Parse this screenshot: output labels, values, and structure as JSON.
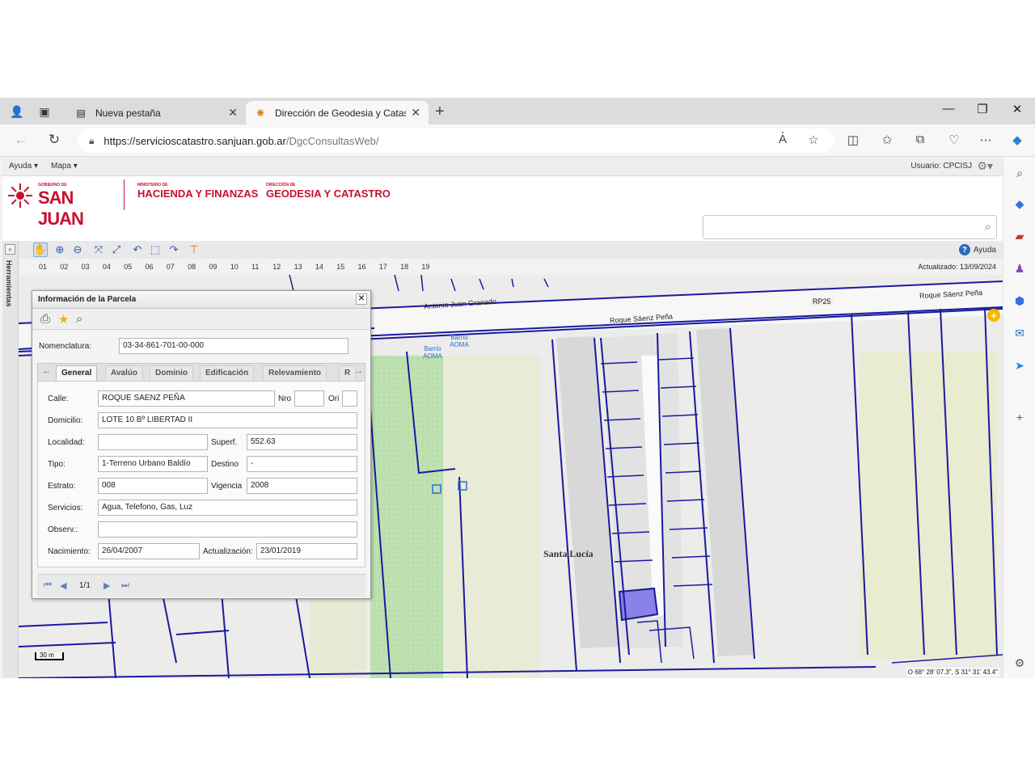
{
  "browser": {
    "tabs": [
      {
        "title": "Nueva pestaña",
        "active": false
      },
      {
        "title": "Dirección de Geodesia y Catastro",
        "active": true
      }
    ],
    "url_host": "https://servicioscatastro.sanjuan.gob.ar",
    "url_path": "/DgcConsultasWeb/"
  },
  "menubar": {
    "help": "Ayuda",
    "map": "Mapa",
    "user": "Usuario: CPCISJ"
  },
  "header": {
    "gob_small": "GOBIERNO DE",
    "gob_big": "SAN JUAN",
    "ministry_small": "MINISTERIO DE",
    "ministry_big": "HACIENDA Y FINANZAS",
    "direction_small": "DIRECCIÓN DE",
    "direction_big": "GEODESIA Y CATASTRO",
    "brand_color": "#c8102e"
  },
  "toolbar": {
    "help": "Ayuda",
    "side_label": "Herramientas",
    "numbers": [
      "01",
      "02",
      "03",
      "04",
      "05",
      "06",
      "07",
      "08",
      "09",
      "10",
      "11",
      "12",
      "13",
      "14",
      "15",
      "16",
      "17",
      "18",
      "19"
    ],
    "updated": "Actualizado: 13/09/2024"
  },
  "map": {
    "labels": {
      "street1": "Antonio Juan Granado",
      "street2": "Roque Sáenz Peña",
      "street3": "Roque Sáenz Peña",
      "route": "RP25",
      "poi1": "Barrio AOMA",
      "poi2": "Barrio AOMA",
      "place": "Santa Lucía"
    },
    "scale": "30 m",
    "coords": "O 68° 28' 07.3\", S 31° 31' 43.4\""
  },
  "panel": {
    "title": "Información de la Parcela",
    "nomenclatura_label": "Nomenclatura:",
    "nomenclatura": "03-34-861-701-00-000",
    "tabs": [
      "General",
      "Avalúo",
      "Dominio",
      "Edificación",
      "Relevamiento",
      "R"
    ],
    "fields": {
      "calle_label": "Calle:",
      "calle": "ROQUE SAENZ PEÑA",
      "nro_label": "Nro",
      "nro": "",
      "ori_label": "Ori",
      "ori": "",
      "domicilio_label": "Domicilio:",
      "domicilio": "LOTE 10  Bº LIBERTAD II",
      "localidad_label": "Localidad:",
      "localidad": "",
      "superf_label": "Superf.",
      "superf": "552.63",
      "tipo_label": "Tipo:",
      "tipo": "1-Terreno Urbano Baldío",
      "destino_label": "Destino",
      "destino": "-",
      "estrato_label": "Estrato:",
      "estrato": "008",
      "vigencia_label": "Vigencia",
      "vigencia": "2008",
      "servicios_label": "Servicios:",
      "servicios": "Agua, Telefono, Gas, Luz",
      "observ_label": "Observ.:",
      "observ": "",
      "nacimiento_label": "Nacimiento:",
      "nacimiento": "26/04/2007",
      "actualizacion_label": "Actualización:",
      "actualizacion": "23/01/2019"
    },
    "pager": "1/1"
  }
}
